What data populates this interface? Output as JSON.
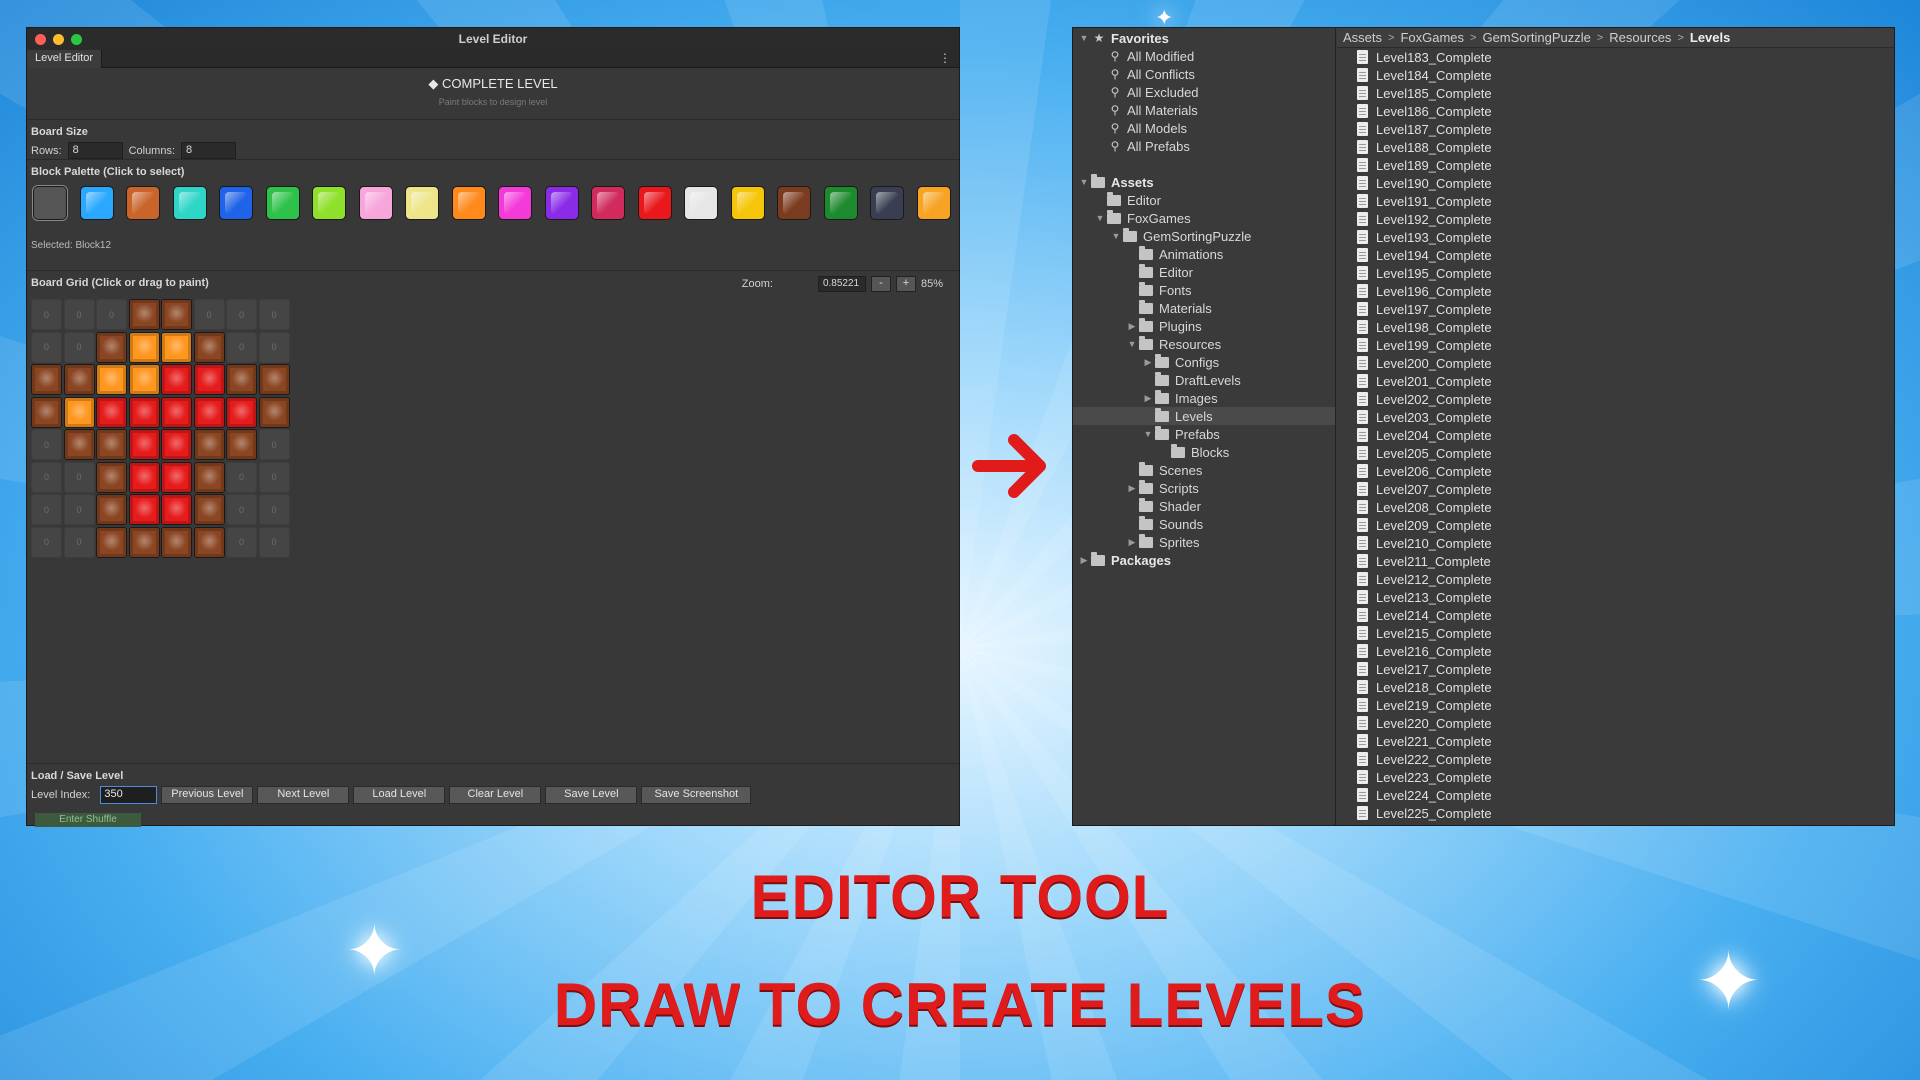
{
  "editor": {
    "window_title": "Level Editor",
    "tab_label": "Level Editor",
    "menu_glyph": "⋮",
    "header_title": "◆ COMPLETE LEVEL",
    "header_subtitle": "Paint blocks to design level",
    "board_size": {
      "title": "Board Size",
      "rows_label": "Rows:",
      "rows_value": "8",
      "columns_label": "Columns:",
      "columns_value": "8"
    },
    "palette": {
      "title": "Block Palette (Click to select)",
      "selected_text": "Selected: Block12",
      "colors": [
        "#555555",
        "#2aa8ff",
        "#c9642a",
        "#2fd6c8",
        "#1f63e8",
        "#2ec24a",
        "#8fe02a",
        "#f7a6dc",
        "#eee58a",
        "#ff8a1c",
        "#f33ad9",
        "#8a2be8",
        "#d12a5c",
        "#e8181c",
        "#e6e6e6",
        "#f5c50a",
        "#7b3b1f",
        "#1e8a2e",
        "#3a3e52",
        "#f7a425"
      ]
    },
    "grid": {
      "title": "Board Grid (Click or drag to paint)",
      "zoom_label": "Zoom:",
      "zoom_value": "0.85221",
      "zoom_minus": "-",
      "zoom_plus": "+",
      "zoom_percent": "85%",
      "empty_label": "0",
      "cells": [
        "EEEBBEEE",
        "EEBOOBEE",
        "BBOORRBB",
        "BORRRRRB",
        "EBBRRBBE",
        "EEBRRBEE",
        "EEBRRBEE",
        "EEBBBBEE"
      ],
      "cell_colors": {
        "B": "#8a4522",
        "O": "#ff961e",
        "R": "#e61c1c"
      }
    },
    "load_save": {
      "title": "Load / Save Level",
      "level_index_label": "Level Index:",
      "level_index_value": "350",
      "buttons": [
        "Previous Level",
        "Next Level",
        "Load Level",
        "Clear Level",
        "Save Level",
        "Save Screenshot"
      ],
      "shuffle_label": "Enter Shuffle"
    }
  },
  "project": {
    "favorites_label": "Favorites",
    "favorites": [
      "All Modified",
      "All Conflicts",
      "All Excluded",
      "All Materials",
      "All Models",
      "All Prefabs"
    ],
    "assets_label": "Assets",
    "tree": [
      {
        "label": "Editor",
        "depth": 1,
        "arrow": ""
      },
      {
        "label": "FoxGames",
        "depth": 1,
        "arrow": "▼"
      },
      {
        "label": "GemSortingPuzzle",
        "depth": 2,
        "arrow": "▼"
      },
      {
        "label": "Animations",
        "depth": 3,
        "arrow": ""
      },
      {
        "label": "Editor",
        "depth": 3,
        "arrow": ""
      },
      {
        "label": "Fonts",
        "depth": 3,
        "arrow": ""
      },
      {
        "label": "Materials",
        "depth": 3,
        "arrow": ""
      },
      {
        "label": "Plugins",
        "depth": 3,
        "arrow": "▶"
      },
      {
        "label": "Resources",
        "depth": 3,
        "arrow": "▼"
      },
      {
        "label": "Configs",
        "depth": 4,
        "arrow": "▶"
      },
      {
        "label": "DraftLevels",
        "depth": 4,
        "arrow": ""
      },
      {
        "label": "Images",
        "depth": 4,
        "arrow": "▶"
      },
      {
        "label": "Levels",
        "depth": 4,
        "arrow": "",
        "selected": true
      },
      {
        "label": "Prefabs",
        "depth": 4,
        "arrow": "▼"
      },
      {
        "label": "Blocks",
        "depth": 5,
        "arrow": ""
      },
      {
        "label": "Scenes",
        "depth": 3,
        "arrow": ""
      },
      {
        "label": "Scripts",
        "depth": 3,
        "arrow": "▶"
      },
      {
        "label": "Shader",
        "depth": 3,
        "arrow": ""
      },
      {
        "label": "Sounds",
        "depth": 3,
        "arrow": ""
      },
      {
        "label": "Sprites",
        "depth": 3,
        "arrow": "▶"
      }
    ],
    "packages_label": "Packages",
    "breadcrumb": [
      "Assets",
      "FoxGames",
      "GemSortingPuzzle",
      "Resources",
      "Levels"
    ],
    "breadcrumb_sep": ">",
    "files": [
      "Level183_Complete",
      "Level184_Complete",
      "Level185_Complete",
      "Level186_Complete",
      "Level187_Complete",
      "Level188_Complete",
      "Level189_Complete",
      "Level190_Complete",
      "Level191_Complete",
      "Level192_Complete",
      "Level193_Complete",
      "Level194_Complete",
      "Level195_Complete",
      "Level196_Complete",
      "Level197_Complete",
      "Level198_Complete",
      "Level199_Complete",
      "Level200_Complete",
      "Level201_Complete",
      "Level202_Complete",
      "Level203_Complete",
      "Level204_Complete",
      "Level205_Complete",
      "Level206_Complete",
      "Level207_Complete",
      "Level208_Complete",
      "Level209_Complete",
      "Level210_Complete",
      "Level211_Complete",
      "Level212_Complete",
      "Level213_Complete",
      "Level214_Complete",
      "Level215_Complete",
      "Level216_Complete",
      "Level217_Complete",
      "Level218_Complete",
      "Level219_Complete",
      "Level220_Complete",
      "Level221_Complete",
      "Level222_Complete",
      "Level223_Complete",
      "Level224_Complete",
      "Level225_Complete"
    ]
  },
  "banner": {
    "line1": "EDITOR TOOL",
    "line2": "DRAW TO CREATE LEVELS",
    "text_color": "#e01b1b"
  }
}
